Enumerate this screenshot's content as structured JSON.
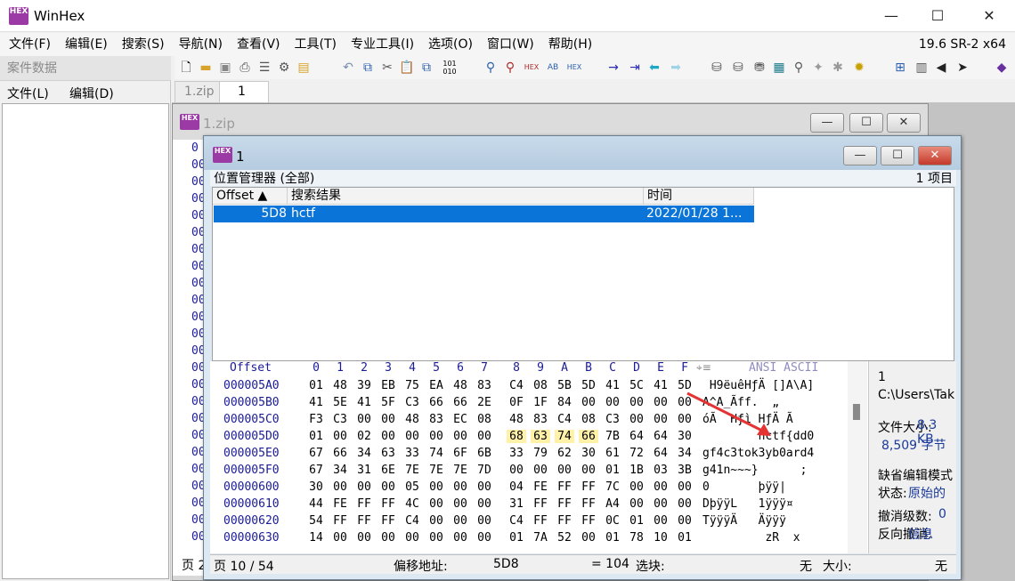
{
  "app": {
    "title": "WinHex",
    "version": "19.6 SR-2 x64",
    "logo_text": "HEX"
  },
  "window_controls": {
    "minimize": "—",
    "maximize": "☐",
    "close": "✕"
  },
  "menu": [
    "文件(F)",
    "编辑(E)",
    "搜索(S)",
    "导航(N)",
    "查看(V)",
    "工具(T)",
    "专业工具(I)",
    "选项(O)",
    "窗口(W)",
    "帮助(H)"
  ],
  "case_panel": {
    "title": "案件数据",
    "menu_file": "文件(L)",
    "menu_edit": "编辑(D)"
  },
  "tabs": [
    "1.zip",
    "1"
  ],
  "back_window": {
    "title": "1.zip",
    "offsets_prefix": [
      "0",
      "00",
      "00",
      "00",
      "00",
      "00",
      "00",
      "00",
      "00",
      "00",
      "00",
      "00",
      "00",
      "00",
      "00",
      "00",
      "00",
      "00",
      "00",
      "00",
      "00",
      "00",
      "00",
      "00"
    ],
    "status_left": "页 2"
  },
  "front_window": {
    "title": "1",
    "position_manager": {
      "title": "位置管理器 (全部)",
      "count": "1 项目",
      "columns": [
        "Offset ▲",
        "搜索结果",
        "时间"
      ],
      "row": {
        "offset": "5D8",
        "result": "hctf",
        "time": "2022/01/28  1..."
      }
    },
    "hex": {
      "header_offset": "Offset",
      "header_cols": [
        "0",
        "1",
        "2",
        "3",
        "4",
        "5",
        "6",
        "7",
        "8",
        "9",
        "A",
        "B",
        "C",
        "D",
        "E",
        "F"
      ],
      "header_ansi": "ANSI ASCII",
      "rows": [
        {
          "offset": "000005A0",
          "bytes": [
            "01",
            "48",
            "39",
            "EB",
            "75",
            "EA",
            "48",
            "83",
            "C4",
            "08",
            "5B",
            "5D",
            "41",
            "5C",
            "41",
            "5D"
          ],
          "ascii": " H9ëuêHƒÄ []A\\A]"
        },
        {
          "offset": "000005B0",
          "bytes": [
            "41",
            "5E",
            "41",
            "5F",
            "C3",
            "66",
            "66",
            "2E",
            "0F",
            "1F",
            "84",
            "00",
            "00",
            "00",
            "00",
            "00"
          ],
          "ascii": "A^A_Ãff.  „"
        },
        {
          "offset": "000005C0",
          "bytes": [
            "F3",
            "C3",
            "00",
            "00",
            "48",
            "83",
            "EC",
            "08",
            "48",
            "83",
            "C4",
            "08",
            "C3",
            "00",
            "00",
            "00"
          ],
          "ascii": "óÃ  Hƒì HƒÄ Ã"
        },
        {
          "offset": "000005D0",
          "bytes": [
            "01",
            "00",
            "02",
            "00",
            "00",
            "00",
            "00",
            "00",
            "68",
            "63",
            "74",
            "66",
            "7B",
            "64",
            "64",
            "30"
          ],
          "ascii": "        hctf{dd0"
        },
        {
          "offset": "000005E0",
          "bytes": [
            "67",
            "66",
            "34",
            "63",
            "33",
            "74",
            "6F",
            "6B",
            "33",
            "79",
            "62",
            "30",
            "61",
            "72",
            "64",
            "34"
          ],
          "ascii": "gf4c3tok3yb0ard4"
        },
        {
          "offset": "000005F0",
          "bytes": [
            "67",
            "34",
            "31",
            "6E",
            "7E",
            "7E",
            "7E",
            "7D",
            "00",
            "00",
            "00",
            "00",
            "01",
            "1B",
            "03",
            "3B"
          ],
          "ascii": "g41n~~~}      ;"
        },
        {
          "offset": "00000600",
          "bytes": [
            "30",
            "00",
            "00",
            "00",
            "05",
            "00",
            "00",
            "00",
            "04",
            "FE",
            "FF",
            "FF",
            "7C",
            "00",
            "00",
            "00"
          ],
          "ascii": "0       þÿÿ|"
        },
        {
          "offset": "00000610",
          "bytes": [
            "44",
            "FE",
            "FF",
            "FF",
            "4C",
            "00",
            "00",
            "00",
            "31",
            "FF",
            "FF",
            "FF",
            "A4",
            "00",
            "00",
            "00"
          ],
          "ascii": "DþÿÿL   1ÿÿÿ¤"
        },
        {
          "offset": "00000620",
          "bytes": [
            "54",
            "FF",
            "FF",
            "FF",
            "C4",
            "00",
            "00",
            "00",
            "C4",
            "FF",
            "FF",
            "FF",
            "0C",
            "01",
            "00",
            "00"
          ],
          "ascii": "TÿÿÿÄ   Äÿÿÿ"
        },
        {
          "offset": "00000630",
          "bytes": [
            "14",
            "00",
            "00",
            "00",
            "00",
            "00",
            "00",
            "00",
            "01",
            "7A",
            "52",
            "00",
            "01",
            "78",
            "10",
            "01"
          ],
          "ascii": "         zR  x"
        }
      ]
    },
    "info": {
      "line1": "1",
      "path": "C:\\Users\\Tak",
      "size_label": "文件大小:",
      "size_kb": "8.3 KB",
      "size_bytes": "8,509 字节",
      "mode_label": "缺省编辑模式",
      "state_label": "状态:",
      "state_value": "原始的",
      "undo_label": "撤消级数:",
      "undo_value": "0",
      "reverse_label": "反向撤消:",
      "reverse_value": "信息"
    },
    "status": {
      "page": "页 10 / 54",
      "offset_label": "偏移地址:",
      "offset_value": "5D8",
      "eq_value": "= 104",
      "block_label": "选块:",
      "block_value": "无",
      "size_label": "大小:",
      "size_value": "无"
    }
  },
  "colors": {
    "selection": "#0a74d9",
    "highlight": "#fff1a8",
    "offset_blue": "#1a1a9a",
    "arrow_red": "#e53232"
  }
}
